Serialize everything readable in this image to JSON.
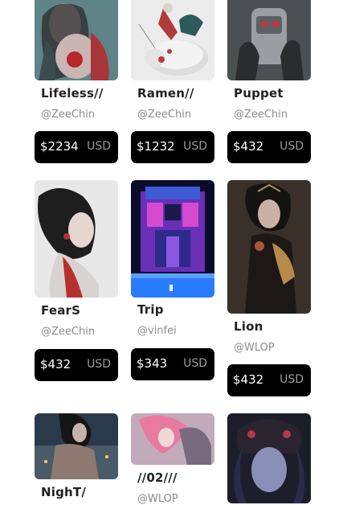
{
  "cards": [
    {
      "title": "Lifeless//",
      "handle": "@ZeeChin",
      "price": "$2234",
      "currency": "USD",
      "image_alt": "lifeless-artwork"
    },
    {
      "title": "Ramen//",
      "handle": "@ZeeChin",
      "price": "$1232",
      "currency": "USD",
      "image_alt": "ramen-artwork"
    },
    {
      "title": "Puppet",
      "handle": "@ZeeChin",
      "price": "$432",
      "currency": "USD",
      "image_alt": "puppet-artwork"
    },
    {
      "title": "FearS",
      "handle": "@ZeeChin",
      "price": "$432",
      "currency": "USD",
      "image_alt": "fears-artwork"
    },
    {
      "title": "Trip",
      "handle": "@vinfei",
      "price": "$343",
      "currency": "USD",
      "image_alt": "trip-artwork"
    },
    {
      "title": "Lion",
      "handle": "@WLOP",
      "price": "$432",
      "currency": "USD",
      "image_alt": "lion-artwork"
    },
    {
      "title": "NighT/",
      "handle": "",
      "price": "",
      "currency": "",
      "image_alt": "night-artwork"
    },
    {
      "title": "//02///",
      "handle": "@WLOP",
      "price": "",
      "currency": "",
      "image_alt": "02-artwork"
    },
    {
      "title": "",
      "handle": "",
      "price": "",
      "currency": "",
      "image_alt": "widow-artwork"
    }
  ],
  "colors": {
    "price_bg": "#000000",
    "price_text": "#ffffff",
    "currency_text": "#9a9a9a",
    "handle_text": "#8a8a8a"
  }
}
